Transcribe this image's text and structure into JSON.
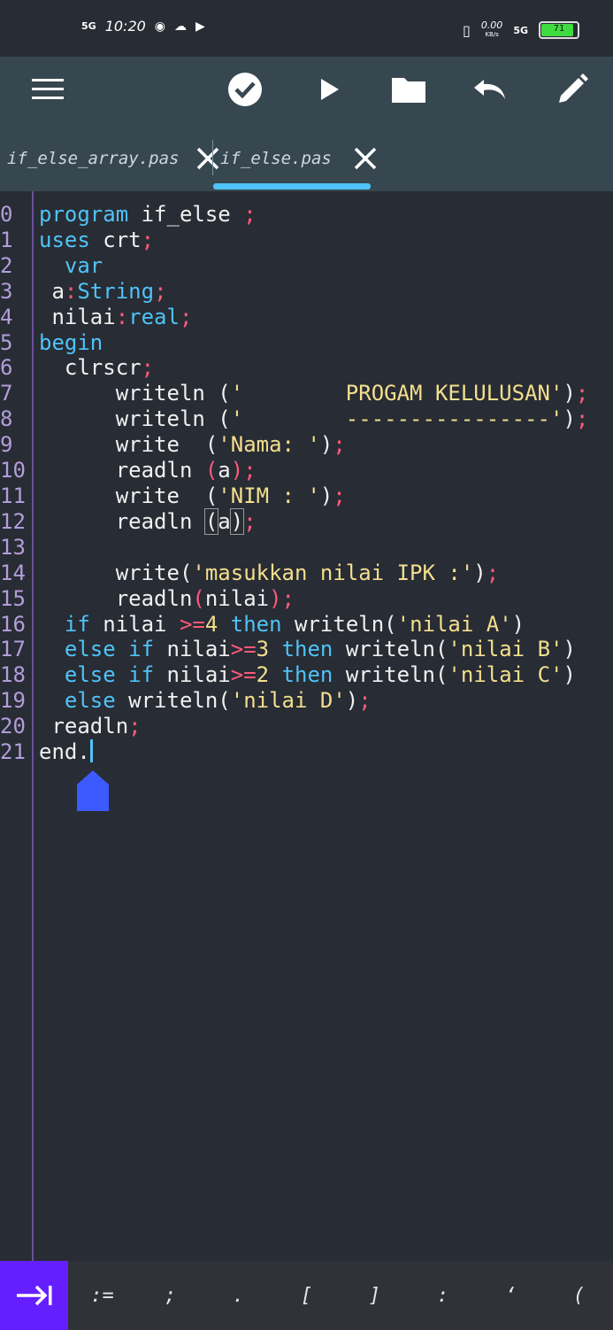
{
  "status": {
    "time": "10:20",
    "left_net": "5G",
    "right_net": "5G",
    "speed_top": "0.00",
    "speed_unit": "KB/s",
    "battery": "71"
  },
  "toolbar": {
    "icons": [
      "menu-icon",
      "check-icon",
      "play-icon",
      "folder-icon",
      "undo-icon",
      "edit-icon"
    ]
  },
  "tabs": [
    {
      "label": "if_else_array.pas"
    },
    {
      "label": "if_else.pas"
    }
  ],
  "code": {
    "line_numbers": [
      "0",
      "1",
      "2",
      "3",
      "4",
      "5",
      "6",
      "7",
      "8",
      "9",
      "10",
      "11",
      "12",
      "13",
      "14",
      "15",
      "16",
      "17",
      "18",
      "19",
      "20",
      "21"
    ]
  },
  "keys": [
    ":=",
    ";",
    ".",
    "[",
    "]",
    ":",
    "‘",
    "("
  ],
  "colors": {
    "accent": "#4fc3f7",
    "keyword": "#4fc3f7",
    "string": "#f3df8e",
    "punct": "#ff5a7a",
    "tab_key": "#651fff",
    "toolbar": "#37474f",
    "editor_bg": "#282c34"
  }
}
